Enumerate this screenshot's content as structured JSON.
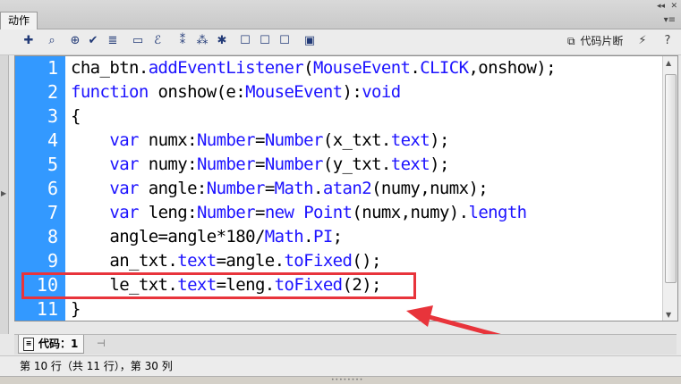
{
  "panel": {
    "tab_title": "动作",
    "collapse_icon": "◂◂",
    "close_icon": "✕",
    "menu_icon": "▾≡"
  },
  "toolbar": {
    "icons": [
      "add-statement-icon",
      "find-icon",
      "target-icon",
      "check-syntax-icon",
      "auto-format-icon",
      "code-hint-icon",
      "debug-options-icon",
      "collapse-braces-icon",
      "collapse-selection-icon",
      "expand-all-icon",
      "apply-block-comment-icon",
      "apply-line-comment-icon",
      "remove-comment-icon",
      "show-hide-toolbox-icon"
    ],
    "snippets_label": "代码片断",
    "wand_icon": "magic-wand-icon",
    "help_icon": "help-icon"
  },
  "editor": {
    "gutter_color": "#3399ff",
    "keyword_color": "#1c12ff",
    "lines": [
      {
        "num": "1",
        "text": "cha_btn.addEventListener(MouseEvent.CLICK,onshow);"
      },
      {
        "num": "2",
        "text": "function onshow(e:MouseEvent):void"
      },
      {
        "num": "3",
        "text": "{"
      },
      {
        "num": "4",
        "text": "    var numx:Number=Number(x_txt.text);"
      },
      {
        "num": "5",
        "text": "    var numy:Number=Number(y_txt.text);"
      },
      {
        "num": "6",
        "text": "    var angle:Number=Math.atan2(numy,numx);"
      },
      {
        "num": "7",
        "text": "    var leng:Number=new Point(numx,numy).length"
      },
      {
        "num": "8",
        "text": "    angle=angle*180/Math.PI;"
      },
      {
        "num": "9",
        "text": "    an_txt.text=angle.toFixed();"
      },
      {
        "num": "10",
        "text": "    le_txt.text=leng.toFixed(2);"
      },
      {
        "num": "11",
        "text": "}"
      }
    ],
    "highlighted_line": "10",
    "highlight_color": "#e8343b"
  },
  "bottom": {
    "code_tab_label": "代码：1",
    "status_text": "第 10 行（共 11 行），第 30 列"
  }
}
